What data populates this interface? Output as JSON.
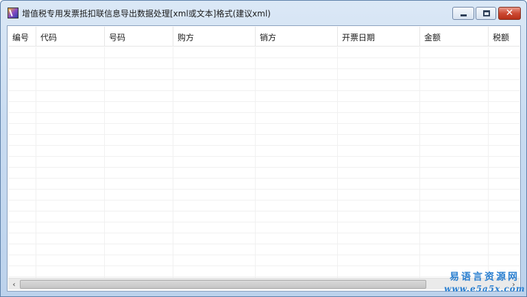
{
  "window": {
    "title": "增值税专用发票抵扣联信息导出数据处理[xml或文本]格式(建议xml)",
    "buttons": {
      "minimize_icon": "minimize-icon",
      "maximize_icon": "maximize-icon",
      "close_icon": "close-icon",
      "close_glyph": "✕"
    }
  },
  "table": {
    "columns": [
      "编号",
      "代码",
      "号码",
      "购方",
      "销方",
      "开票日期",
      "金额",
      "税额"
    ],
    "rows": []
  },
  "scrollbar": {
    "left_arrow": "‹",
    "right_arrow": "›"
  },
  "watermark": {
    "line1": "易语言资源网",
    "line2": "www.e5a5x.com"
  },
  "colors": {
    "close_button": "#cc4a33",
    "watermark": "#2a7fd0"
  }
}
